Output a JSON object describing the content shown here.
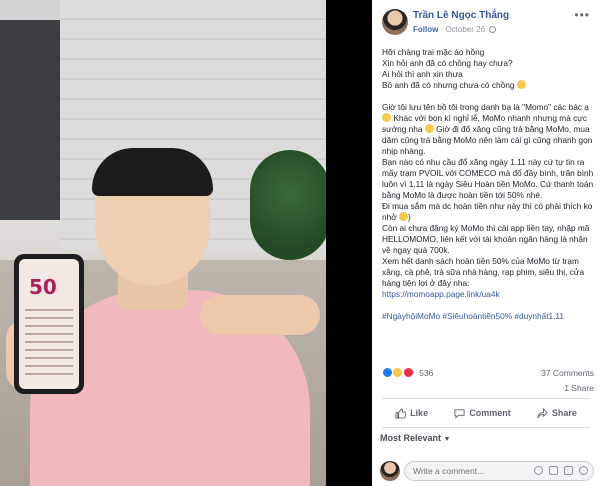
{
  "post": {
    "author": "Trần Lê Ngọc Thắng",
    "follow_label": "Follow",
    "date": "October 26",
    "more_label": "•••",
    "paragraphs": [
      [
        "Hỡi chàng trai mặc áo hồng",
        "Xin hỏi anh đã có chồng hay chưa?",
        "Ai hỏi thì anh xin thưa",
        "Bồ anh đã có nhưng chưa có chồng"
      ],
      [
        "Giờ tôi lưu tên bồ tôi trong danh bạ là \"Momo\" các bác ạ",
        " Khác với bọn kì nghỉ lễ, MoMo nhanh nhưng mà cực sướng nha",
        " Giờ đi đổ xăng cũng trả bằng MoMo, mua dăm cũng trả bằng MoMo nên làm cái gì cũng nhanh gọn nhịp nhàng.",
        "Bạn nào có nhu cầu đổ xăng ngày 1.11 này cứ tự tin ra mấy trạm PVOIL với COMECO mà đổ đầy bình, trăn bình luôn vì 1.11 là ngày Siêu Hoàn tiền MoMo. Cứ thanh toán bằng MoMo là được hoàn tiền tới 50% nhé.",
        "Đi mua sắm mà dc hoàn tiền như này thì có phải thích ko nhở",
        ")",
        "Còn ai chưa đăng ký MoMo thì cài app liền tay, nhập mã HELLOMOMO, liên kết với tài khoản ngân hàng là nhận về ngay quà 700k.",
        "Xem hết danh sách hoàn tiền 50% của MoMo từ trạm xăng, cà phê, trà sữa nhà hàng, rạp phim, siêu thị, cửa hàng tiện lợi ở đây nha:"
      ],
      [
        "https://momoapp.page.link/ua4k"
      ],
      [
        "#NgàyhộiMoMo #Siêuhoàntiền50% #duynhất1.11"
      ]
    ],
    "reaction_count": "536",
    "comments_count": "37 Comments",
    "shares_count": "1 Share",
    "actions": {
      "like": "Like",
      "comment": "Comment",
      "share": "Share"
    },
    "sort_label": "Most Relevant",
    "comment_placeholder": "Write a comment..."
  },
  "photo": {
    "phone_screen_text": "50"
  },
  "icons": [
    "dots-icon",
    "globe-icon",
    "like-icon",
    "comment-icon",
    "share-icon",
    "emoji-icon",
    "camera-icon",
    "gif-icon",
    "sticker-icon"
  ],
  "colors": {
    "link": "#385898",
    "like": "#2078f4",
    "love": "#f0284a",
    "shirt": "#f1b8bf"
  }
}
